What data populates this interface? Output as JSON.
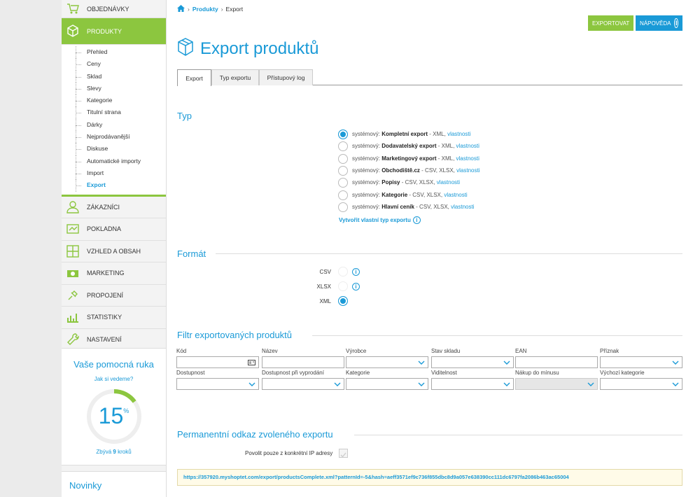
{
  "sidebar": {
    "top_items": [
      {
        "label": "Objednávky"
      },
      {
        "label": "Produkty"
      }
    ],
    "sub_items": [
      "Přehled",
      "Ceny",
      "Sklad",
      "Slevy",
      "Kategorie",
      "Titulní strana",
      "Dárky",
      "Nejprodávanější",
      "Diskuse",
      "Automatické importy",
      "Import",
      "Export"
    ],
    "bottom_items": [
      {
        "label": "Zákazníci"
      },
      {
        "label": "Pokladna"
      },
      {
        "label": "Vzhled a obsah"
      },
      {
        "label": "Marketing"
      },
      {
        "label": "Propojení"
      },
      {
        "label": "Statistiky"
      },
      {
        "label": "Nastavení"
      }
    ],
    "helper": {
      "title": "Vaše pomocná ruka",
      "link": "Jak si vedeme?",
      "percent": "15",
      "percent_sign": "%",
      "progress": 0.15,
      "remaining_prefix": "Zbývá",
      "remaining_count": "9",
      "remaining_suffix": "kroků"
    },
    "news_title": "Novinky"
  },
  "breadcrumb": {
    "section": "Produkty",
    "current": "Export"
  },
  "buttons": {
    "export": "Exportovat",
    "help": "Nápověda"
  },
  "colors": {
    "accent": "#1a9ad7",
    "green": "#8cc63f"
  },
  "page_title": "Export produktů",
  "tabs": [
    "Export",
    "Typ exportu",
    "Přístupový log"
  ],
  "type_section": {
    "title": "Typ",
    "options": [
      {
        "prefix": "systémový:",
        "name": "Kompletní export",
        "formats": "- XML,",
        "link": "vlastnosti",
        "checked": true
      },
      {
        "prefix": "systémový:",
        "name": "Dodavatelský export",
        "formats": "- XML,",
        "link": "vlastnosti",
        "checked": false
      },
      {
        "prefix": "systémový:",
        "name": "Marketingový export",
        "formats": "- XML,",
        "link": "vlastnosti",
        "checked": false
      },
      {
        "prefix": "systémový:",
        "name": "Obchodiště.cz",
        "formats": "- CSV, XLSX,",
        "link": "vlastnosti",
        "checked": false
      },
      {
        "prefix": "systémový:",
        "name": "Popisy",
        "formats": "- CSV, XLSX,",
        "link": "vlastnosti",
        "checked": false
      },
      {
        "prefix": "systémový:",
        "name": "Kategorie",
        "formats": "- CSV, XLSX,",
        "link": "vlastnosti",
        "checked": false
      },
      {
        "prefix": "systémový:",
        "name": "Hlavní ceník",
        "formats": "- CSV, XLSX,",
        "link": "vlastnosti",
        "checked": false
      }
    ],
    "create_link": "Vytvořit vlastní typ exportu"
  },
  "format_section": {
    "title": "Formát",
    "options": [
      {
        "label": "CSV",
        "checked": false
      },
      {
        "label": "XLSX",
        "checked": false
      },
      {
        "label": "XML",
        "checked": true
      }
    ]
  },
  "filter_section": {
    "title": "Filtr exportovaných produktů",
    "row1": [
      "Kód",
      "Název",
      "Výrobce",
      "Stav skladu",
      "EAN",
      "Příznak"
    ],
    "row2": [
      "Dostupnost",
      "Dostupnost při vyprodání",
      "Kategorie",
      "Viditelnost",
      "Nákup do mínusu",
      "Výchozí kategorie"
    ]
  },
  "permalink_section": {
    "title": "Permanentní odkaz zvoleného exportu",
    "ip_label": "Povolit pouze z konkrétní IP adresy",
    "url": "https://357920.myshoptet.com/export/productsComplete.xml?patternId=-5&hash=aeff3571ef9c736f855dbc8d9a057e638390cc111dc6797fa2086b463ac65004"
  }
}
